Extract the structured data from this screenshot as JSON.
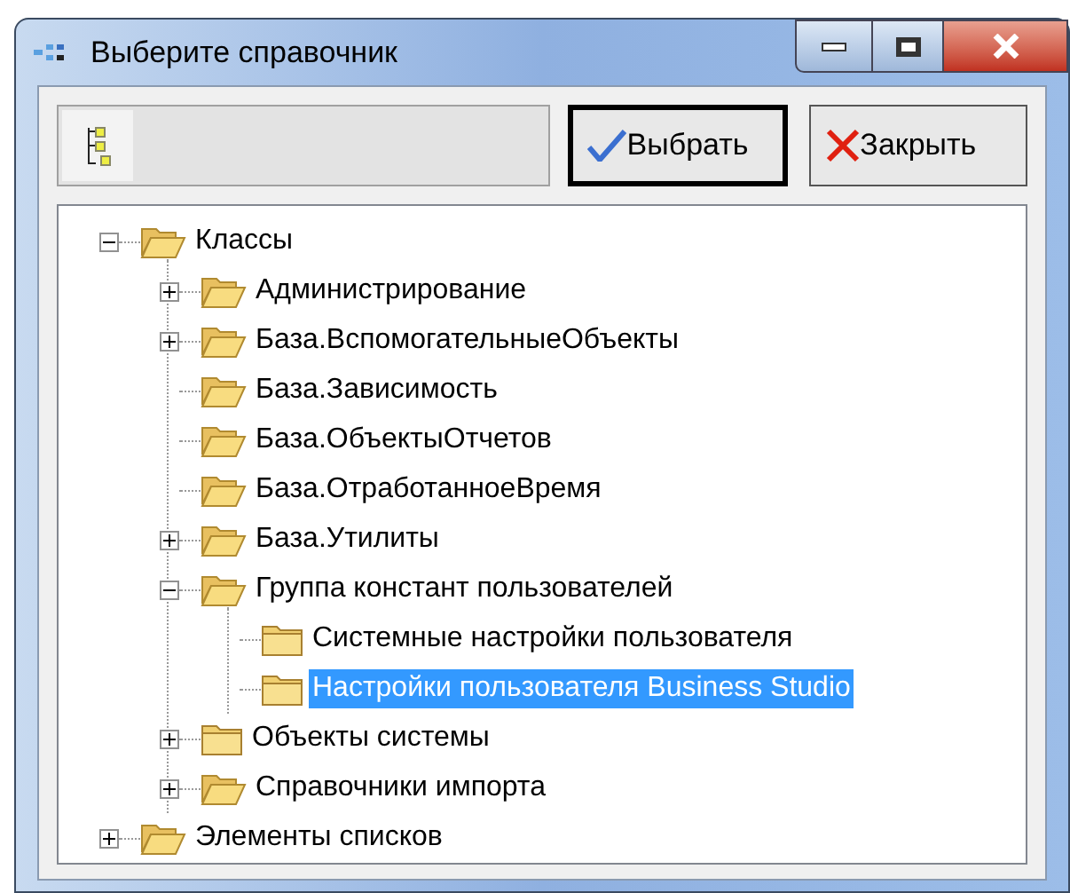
{
  "window": {
    "title": "Выберите справочник"
  },
  "toolbar": {
    "buttons": [
      {
        "label": "Выбрать",
        "kind": "check",
        "default": true
      },
      {
        "label": "Закрыть",
        "kind": "close",
        "default": false
      }
    ]
  },
  "tree": [
    {
      "label": "Классы",
      "kind": "branch",
      "expanded": true,
      "open_folder": true,
      "selected": false,
      "children": [
        {
          "label": "Администрирование",
          "kind": "branch",
          "expanded": false,
          "open_folder": true,
          "selected": false
        },
        {
          "label": "База.ВспомогательныеОбъекты",
          "kind": "branch",
          "expanded": false,
          "open_folder": true,
          "selected": false
        },
        {
          "label": "База.Зависимость",
          "kind": "leaf",
          "open_folder": true,
          "selected": false
        },
        {
          "label": "База.ОбъектыОтчетов",
          "kind": "leaf",
          "open_folder": true,
          "selected": false
        },
        {
          "label": "База.ОтработанноеВремя",
          "kind": "leaf",
          "open_folder": true,
          "selected": false
        },
        {
          "label": "База.Утилиты",
          "kind": "branch",
          "expanded": false,
          "open_folder": true,
          "selected": false
        },
        {
          "label": "Группа констант пользователей",
          "kind": "branch",
          "expanded": true,
          "open_folder": true,
          "selected": false,
          "children": [
            {
              "label": "Системные настройки пользователя",
              "kind": "leaf",
              "open_folder": false,
              "selected": false
            },
            {
              "label": "Настройки пользователя Business Studio",
              "kind": "leaf",
              "open_folder": false,
              "selected": true
            }
          ]
        },
        {
          "label": "Объекты системы",
          "kind": "branch",
          "expanded": false,
          "open_folder": false,
          "selected": false
        },
        {
          "label": "Справочники импорта",
          "kind": "branch",
          "expanded": false,
          "open_folder": true,
          "selected": false
        }
      ]
    },
    {
      "label": "Элементы списков",
      "kind": "branch",
      "expanded": false,
      "open_folder": true,
      "selected": false
    }
  ]
}
